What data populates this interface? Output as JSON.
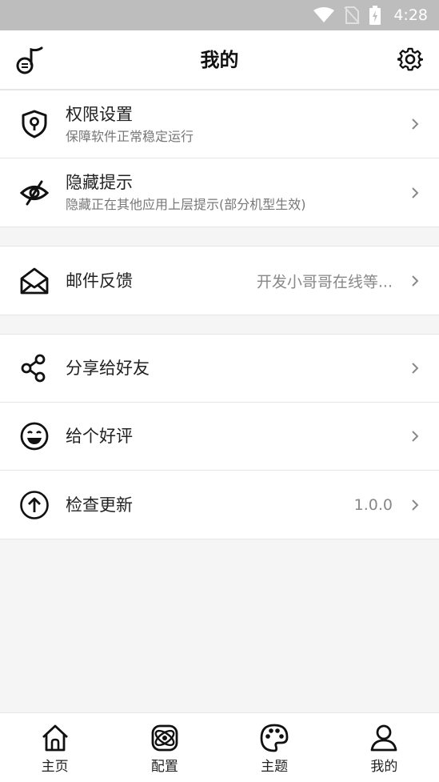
{
  "status_bar": {
    "time": "4:28"
  },
  "app_bar": {
    "title": "我的"
  },
  "groups": [
    {
      "rows": [
        {
          "label": "权限设置",
          "sublabel": "保障软件正常稳定运行",
          "icon": "shield-keyhole-icon"
        },
        {
          "label": "隐藏提示",
          "sublabel": "隐藏正在其他应用上层提示(部分机型生效)",
          "icon": "eye-off-icon"
        }
      ]
    },
    {
      "rows": [
        {
          "label": "邮件反馈",
          "value": "开发小哥哥在线等...",
          "icon": "mail-open-icon"
        }
      ]
    },
    {
      "rows": [
        {
          "label": "分享给好友",
          "icon": "share-icon"
        },
        {
          "label": "给个好评",
          "icon": "smile-icon"
        },
        {
          "label": "检查更新",
          "value": "1.0.0",
          "icon": "arrow-up-circle-icon"
        }
      ]
    }
  ],
  "bottom_nav": {
    "items": [
      {
        "label": "主页",
        "icon": "home-icon"
      },
      {
        "label": "配置",
        "icon": "config-icon"
      },
      {
        "label": "主题",
        "icon": "palette-icon"
      },
      {
        "label": "我的",
        "icon": "user-icon"
      }
    ]
  }
}
